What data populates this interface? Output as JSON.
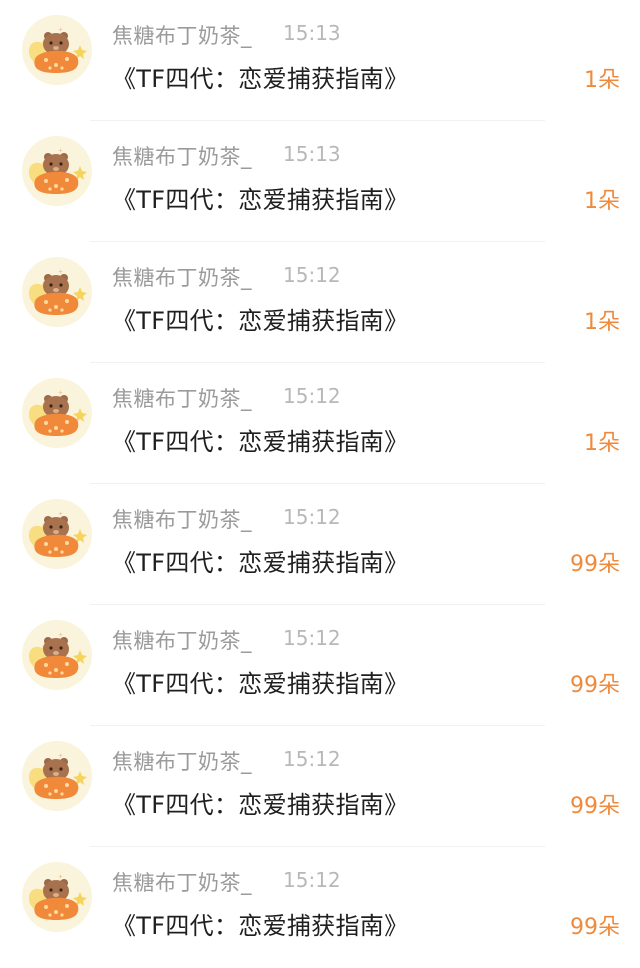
{
  "colors": {
    "background": "#ffffff",
    "username": "#9b9b9b",
    "time": "#b8b8b8",
    "message": "#1f1f1f",
    "gift_count": "#ef8a3c",
    "avatar_bg": "#fbf4dc"
  },
  "items": [
    {
      "avatar_icon": "bear-with-orange-pillow-icon",
      "username": "焦糖布丁奶茶_",
      "time": "15:13",
      "message": "《TF四代：恋爱捕获指南》",
      "gift": "1朵"
    },
    {
      "avatar_icon": "bear-with-orange-pillow-icon",
      "username": "焦糖布丁奶茶_",
      "time": "15:13",
      "message": "《TF四代：恋爱捕获指南》",
      "gift": "1朵"
    },
    {
      "avatar_icon": "bear-with-orange-pillow-icon",
      "username": "焦糖布丁奶茶_",
      "time": "15:12",
      "message": "《TF四代：恋爱捕获指南》",
      "gift": "1朵"
    },
    {
      "avatar_icon": "bear-with-orange-pillow-icon",
      "username": "焦糖布丁奶茶_",
      "time": "15:12",
      "message": "《TF四代：恋爱捕获指南》",
      "gift": "1朵"
    },
    {
      "avatar_icon": "bear-with-orange-pillow-icon",
      "username": "焦糖布丁奶茶_",
      "time": "15:12",
      "message": "《TF四代：恋爱捕获指南》",
      "gift": "99朵"
    },
    {
      "avatar_icon": "bear-with-orange-pillow-icon",
      "username": "焦糖布丁奶茶_",
      "time": "15:12",
      "message": "《TF四代：恋爱捕获指南》",
      "gift": "99朵"
    },
    {
      "avatar_icon": "bear-with-orange-pillow-icon",
      "username": "焦糖布丁奶茶_",
      "time": "15:12",
      "message": "《TF四代：恋爱捕获指南》",
      "gift": "99朵"
    },
    {
      "avatar_icon": "bear-with-orange-pillow-icon",
      "username": "焦糖布丁奶茶_",
      "time": "15:12",
      "message": "《TF四代：恋爱捕获指南》",
      "gift": "99朵"
    }
  ]
}
